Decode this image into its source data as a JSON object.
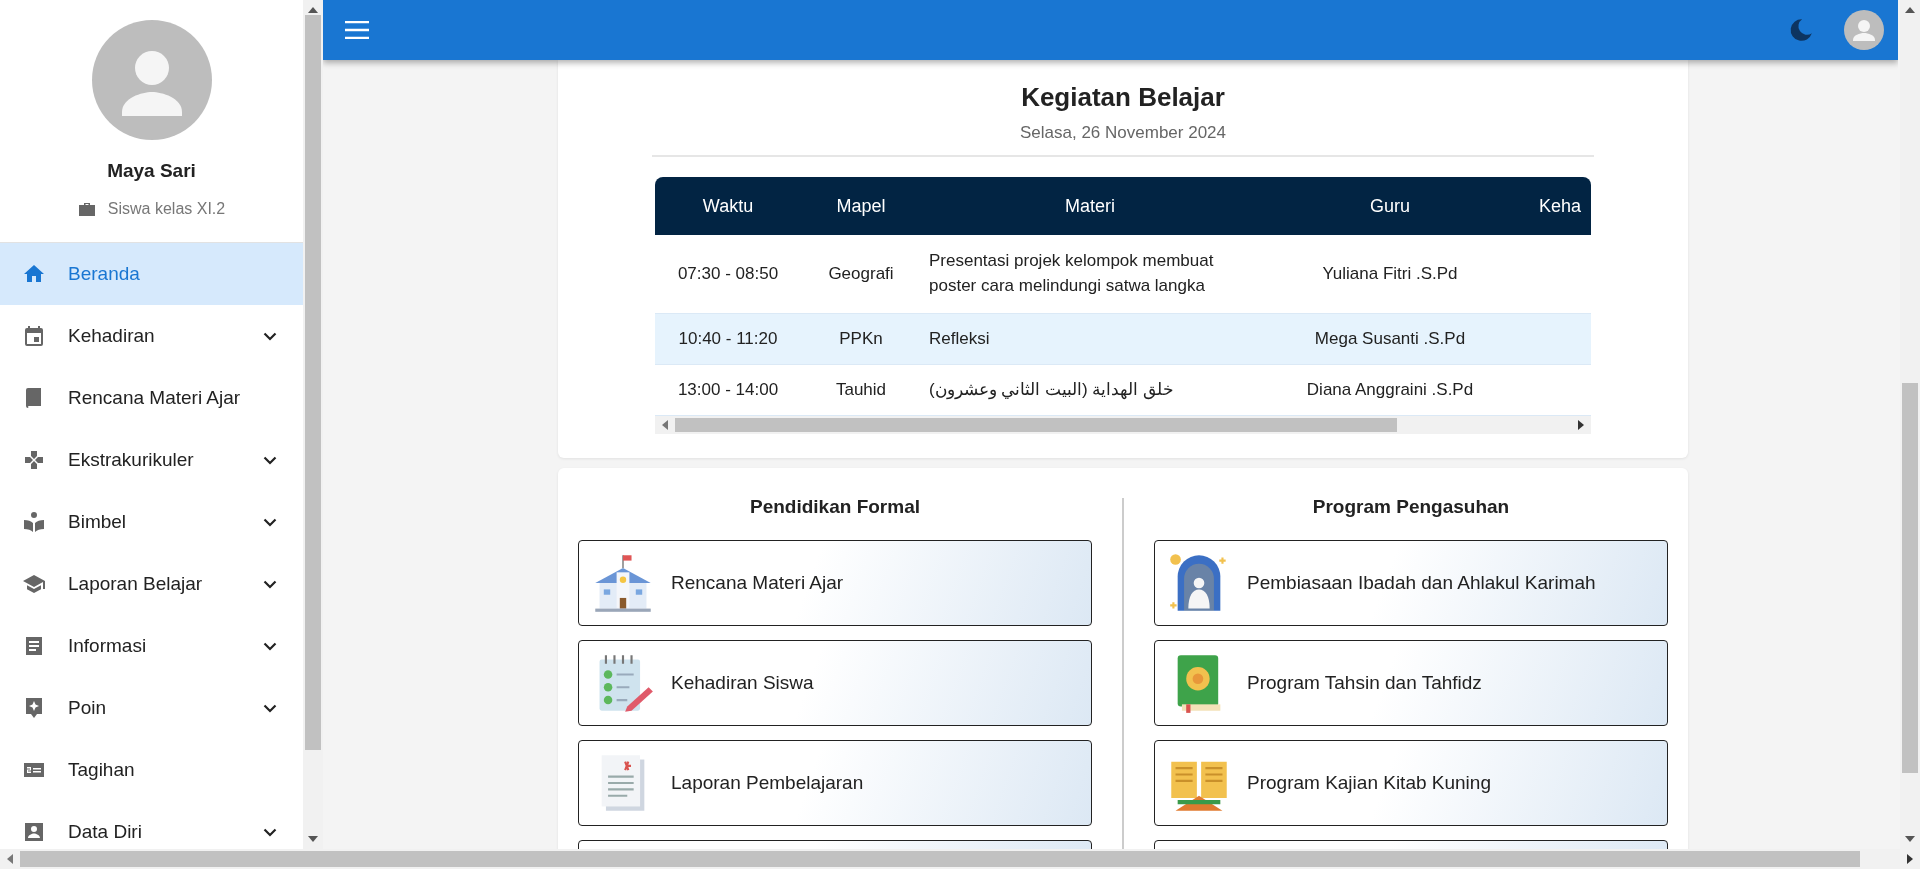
{
  "sidebar": {
    "profile": {
      "name": "Maya Sari",
      "role": "Siswa kelas XI.2"
    },
    "items": [
      {
        "label": "Beranda",
        "selected": true,
        "expandable": false
      },
      {
        "label": "Kehadiran",
        "selected": false,
        "expandable": true
      },
      {
        "label": "Rencana Materi Ajar",
        "selected": false,
        "expandable": false
      },
      {
        "label": "Ekstrakurikuler",
        "selected": false,
        "expandable": true
      },
      {
        "label": "Bimbel",
        "selected": false,
        "expandable": true
      },
      {
        "label": "Laporan Belajar",
        "selected": false,
        "expandable": true
      },
      {
        "label": "Informasi",
        "selected": false,
        "expandable": true
      },
      {
        "label": "Poin",
        "selected": false,
        "expandable": true
      },
      {
        "label": "Tagihan",
        "selected": false,
        "expandable": false
      },
      {
        "label": "Data Diri",
        "selected": false,
        "expandable": true
      }
    ]
  },
  "schedule": {
    "title": "Kegiatan Belajar",
    "date": "Selasa, 26 November 2024",
    "table": {
      "columns": [
        "Waktu",
        "Mapel",
        "Materi",
        "Guru",
        "Keha"
      ],
      "rows": [
        {
          "selected": false,
          "cells": [
            "07:30 - 08:50",
            "Geografi",
            "Presentasi projek kelompok membuat poster cara melindungi satwa langka",
            "Yuliana Fitri .S.Pd"
          ]
        },
        {
          "selected": true,
          "cells": [
            "10:40 - 11:20",
            "PPKn",
            "Refleksi",
            "Mega Susanti .S.Pd"
          ]
        },
        {
          "selected": false,
          "cells": [
            "13:00 - 14:00",
            "Tauhid",
            "خلق الهداية (البيت الثاني وعشرون)",
            "Diana Anggraini .S.Pd"
          ]
        }
      ]
    }
  },
  "programs": [
    {
      "title": "Pendidikan Formal",
      "items": [
        "Rencana Materi Ajar",
        "Kehadiran Siswa",
        "Laporan Pembelajaran"
      ]
    },
    {
      "title": "Program Pengasuhan",
      "items": [
        "Pembiasaan Ibadah dan Ahlakul Karimah",
        "Program Tahsin dan Tahfidz",
        "Program Kajian Kitab Kuning"
      ]
    }
  ]
}
